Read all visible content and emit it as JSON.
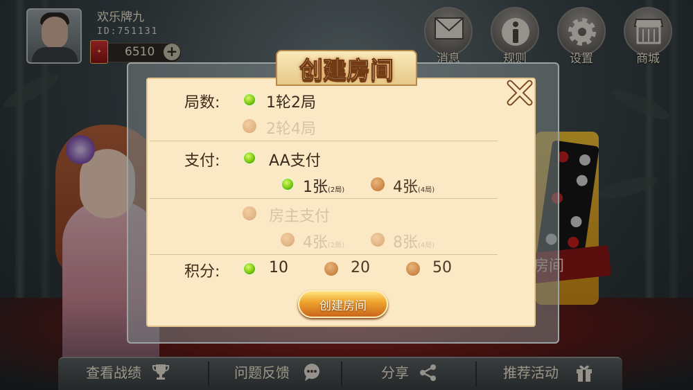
{
  "user": {
    "name": "欢乐牌九",
    "id": "ID:751131",
    "coins": "6510"
  },
  "top_menu": [
    {
      "label": "消息",
      "icon": "envelope-icon"
    },
    {
      "label": "规则",
      "icon": "info-icon"
    },
    {
      "label": "设置",
      "icon": "gear-icon"
    },
    {
      "label": "商城",
      "icon": "store-icon"
    }
  ],
  "bottom_bar": [
    {
      "label": "查看战绩",
      "icon": "trophy-icon"
    },
    {
      "label": "问题反馈",
      "icon": "chat-bubble-icon"
    },
    {
      "label": "分享",
      "icon": "share-icon"
    },
    {
      "label": "推荐活动",
      "icon": "gift-icon"
    }
  ],
  "background": {
    "room_label": "房间"
  },
  "dialog": {
    "title": "创建房间",
    "rounds": {
      "label": "局数:",
      "options": [
        {
          "text": "1轮2局",
          "selected": true,
          "enabled": true
        },
        {
          "text": "2轮4局",
          "selected": false,
          "enabled": false
        }
      ]
    },
    "payment": {
      "label": "支付:",
      "aa": {
        "text": "AA支付",
        "selected": true,
        "cards": [
          {
            "text": "1张",
            "note": "(2局)",
            "selected": true
          },
          {
            "text": "4张",
            "note": "(4局)",
            "selected": false
          }
        ]
      },
      "owner": {
        "text": "房主支付",
        "selected": false,
        "enabled": false,
        "cards": [
          {
            "text": "4张",
            "note": "(2局)",
            "enabled": false
          },
          {
            "text": "8张",
            "note": "(4局)",
            "enabled": false
          }
        ]
      }
    },
    "score": {
      "label": "积分:",
      "options": [
        {
          "text": "10",
          "selected": true
        },
        {
          "text": "20",
          "selected": false
        },
        {
          "text": "50",
          "selected": false
        }
      ]
    },
    "create_button": "创建房间"
  },
  "colors": {
    "selected_radio": "#7ccb10",
    "unselected_radio": "#c98544",
    "panel": "#fbe9c6",
    "button": "#f0a62d"
  }
}
